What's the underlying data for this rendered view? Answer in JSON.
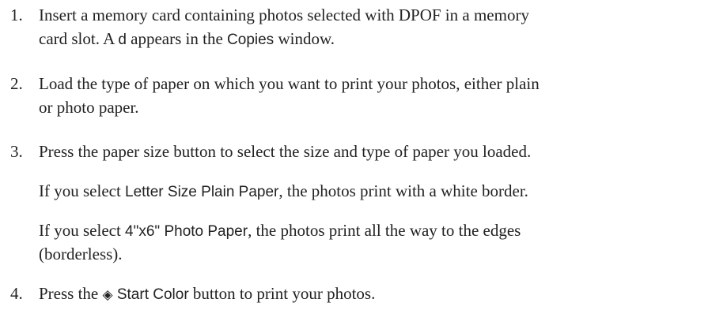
{
  "steps": [
    {
      "number": "1.",
      "line1_a": "Insert a memory card containing photos selected with DPOF in a memory",
      "line2_a": "card slot. A ",
      "line2_ui1": "d",
      "line2_b": " appears in the ",
      "line2_ui2": "Copies",
      "line2_c": " window."
    },
    {
      "number": "2.",
      "line1": "Load the type of paper on which you want to print your photos, either plain",
      "line2": "or photo paper."
    },
    {
      "number": "3.",
      "line1": "Press the paper size button to select the size and type of paper you loaded.",
      "para1_a": "If you select ",
      "para1_ui": "Letter Size Plain Paper",
      "para1_b": ", the photos print with a white border.",
      "para2_a": "If you select ",
      "para2_ui": "4\"x6\" Photo Paper",
      "para2_b": ", the photos print all the way to the edges",
      "para2_line2": "(borderless)."
    },
    {
      "number": "4.",
      "line1_a": "Press the ",
      "icon_name": "start-diamond-icon",
      "icon_glyph": "◈",
      "line1_ui": "Start Color",
      "line1_b": " button to print your photos."
    }
  ]
}
